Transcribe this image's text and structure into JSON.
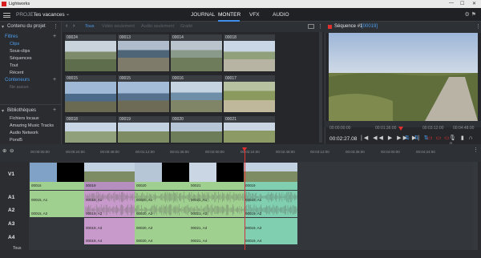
{
  "window": {
    "title": "Lightworks",
    "min": "—",
    "max": "☐",
    "close": "✕"
  },
  "topbar": {
    "project_label": "PROJET",
    "project_name": "les vacances",
    "tabs": [
      "JOURNAL",
      "MONTER",
      "VFX",
      "AUDIO"
    ],
    "active_tab": "MONTER"
  },
  "left_panel": {
    "title": "Contenu du projet",
    "filters_header": "Filtres",
    "filters": [
      "Clips",
      "Sous-clips",
      "Séquences",
      "Tout",
      "Récent"
    ],
    "containers_header": "Conteneurs",
    "containers_empty": "Ne aucun",
    "libraries_header": "Bibliothèques",
    "libraries": [
      "Fichiers locaux",
      "Amazing Music Tracks",
      "Audio Network",
      "Pond5"
    ]
  },
  "browser": {
    "tabs": [
      "Tous",
      "Vidéo seulement",
      "Audio seulement",
      "Gradé"
    ],
    "active_tab": "Tous",
    "clips": [
      "00024",
      "00013",
      "00014",
      "00018",
      "00015",
      "00015",
      "00016",
      "00017",
      "00018",
      "00019",
      "00020",
      "00021"
    ]
  },
  "viewer": {
    "title": "Séquence #1",
    "tag": "[00019]",
    "tc_in": "00:00:00:00",
    "tc_mid": "00:01:36:00",
    "tc_end": "00:03:12:00",
    "tc_right": "00:04:48:00",
    "current_tc": "00:02:27.08"
  },
  "timeline": {
    "ruler": [
      "00:00:00:00",
      "00:00:24:00",
      "00:00:48:00",
      "00:01:12:00",
      "00:01:36:00",
      "00:02:00:00",
      "00:02:24:00",
      "00:02:48:00",
      "00:03:12:00",
      "00:03:36:00",
      "00:04:00:00",
      "00:04:24:00"
    ],
    "tracks": [
      "V1",
      "A1",
      "A2",
      "A3",
      "A4"
    ],
    "all_label": "Tous",
    "video_clips": [
      "00015",
      "00019",
      "00020",
      "00021",
      "00019"
    ],
    "audio_a1": [
      "00015, A1",
      "00019, A1",
      "00020, A1",
      "00021, A1",
      "00019, A1"
    ],
    "audio_a2": [
      "00015, A2",
      "00019, A2",
      "00020, A2",
      "00021, A2",
      "00019, A2"
    ],
    "audio_a3": [
      "00019, A3",
      "00020, A3",
      "00021, A3",
      "00019, A3"
    ],
    "audio_a4": [
      "00019, A4",
      "00020, A4",
      "00021, A4",
      "00019, A4"
    ]
  }
}
